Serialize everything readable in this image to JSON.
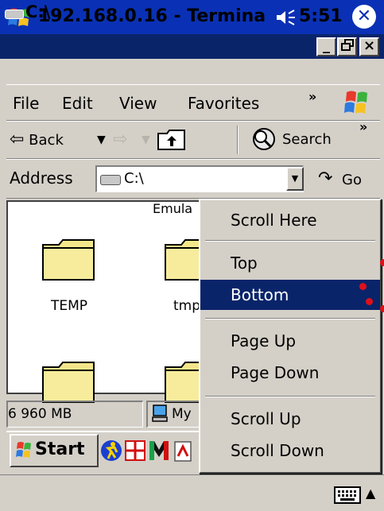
{
  "topbar": {
    "title": "192.168.0.16 - Termina",
    "clock": "5:51"
  },
  "window": {
    "title": "C:\\",
    "min_label": "_",
    "max_label": "🗗",
    "close_label": "×"
  },
  "menubar": {
    "file": "File",
    "edit": "Edit",
    "view": "View",
    "favorites": "Favorites",
    "more": "»"
  },
  "toolbar": {
    "back": "Back",
    "search": "Search",
    "more": "»"
  },
  "address": {
    "label": "Address",
    "value": "C:\\",
    "go": "Go"
  },
  "content": {
    "partial_label": "Emula",
    "items": [
      {
        "label": "TEMP"
      },
      {
        "label": "tmp"
      }
    ]
  },
  "status": {
    "size": "6 960 MB",
    "location": "My"
  },
  "taskbar": {
    "start": "Start"
  },
  "context_menu": {
    "scroll_here": "Scroll Here",
    "top": "Top",
    "bottom": "Bottom",
    "page_up": "Page Up",
    "page_down": "Page Down",
    "scroll_up": "Scroll Up",
    "scroll_down": "Scroll Down",
    "highlight_color": "#0a246a"
  },
  "colors": {
    "pocketpc_bar": "#0a31b5",
    "titlebar": "#0a246a",
    "face": "#d4d0c8",
    "marker": "#e0101a"
  }
}
